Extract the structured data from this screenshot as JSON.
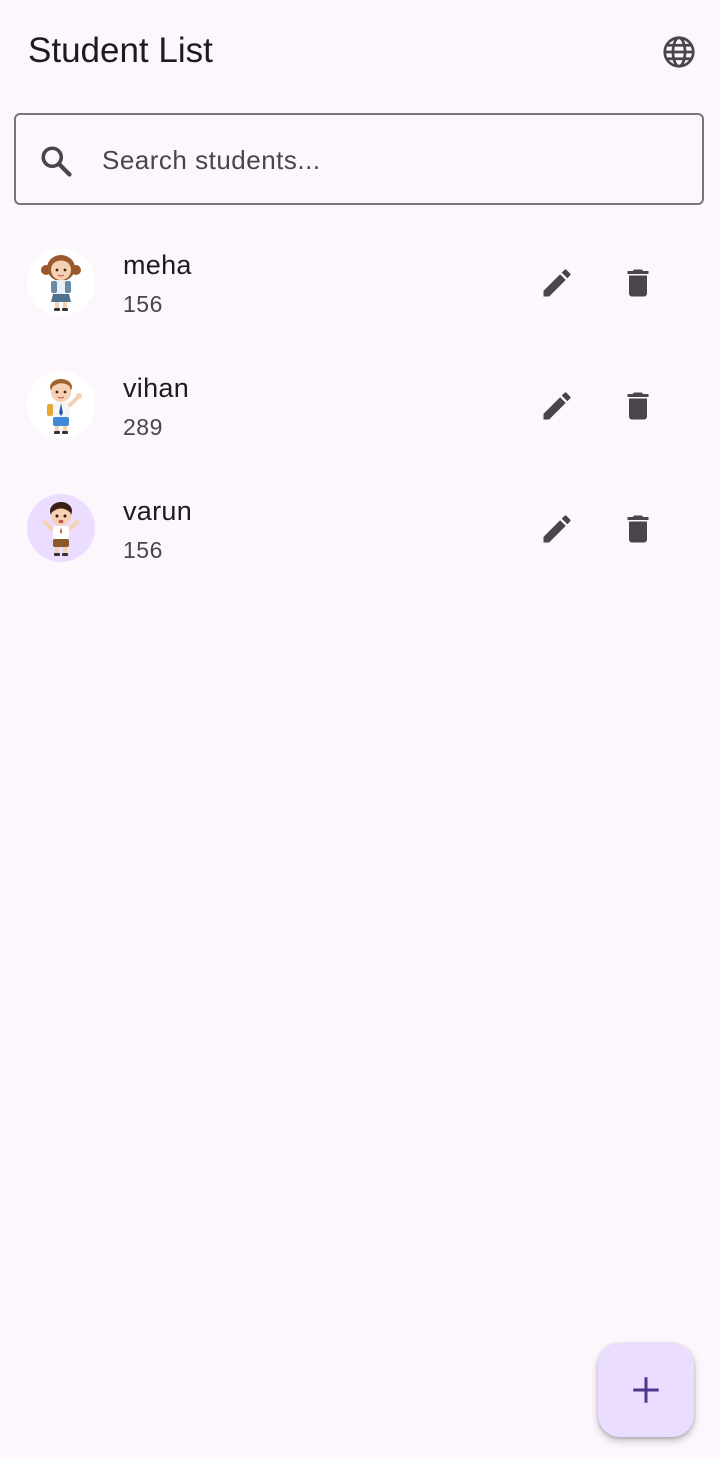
{
  "app_bar": {
    "title": "Student List",
    "language_icon": "globe-icon"
  },
  "search": {
    "placeholder": "Search students...",
    "value": "",
    "icon": "search-icon"
  },
  "students": [
    {
      "name": "meha",
      "number": "156",
      "avatar": "girl-student-avatar"
    },
    {
      "name": "vihan",
      "number": "289",
      "avatar": "boy-student-avatar"
    },
    {
      "name": "varun",
      "number": "156",
      "avatar": "kid-student-avatar"
    }
  ],
  "row_actions": {
    "edit_icon": "pencil-icon",
    "delete_icon": "trash-icon"
  },
  "fab": {
    "icon": "plus-icon"
  },
  "colors": {
    "background": "#fdf7fd",
    "text_primary": "#1d1b20",
    "text_secondary": "#49454f",
    "icon": "#49454f",
    "fab_background": "#eaddff",
    "fab_icon": "#4f378b",
    "outline": "#79747e"
  }
}
